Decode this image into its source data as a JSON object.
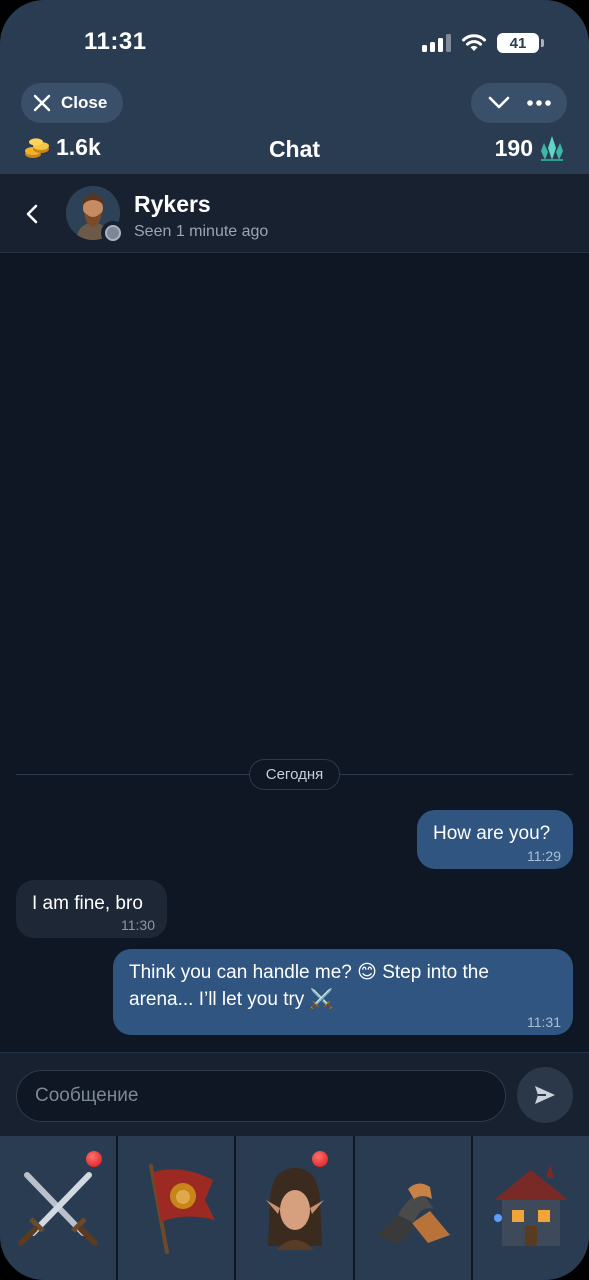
{
  "status_bar": {
    "time": "11:31",
    "battery": "41"
  },
  "header": {
    "close_label": "Close",
    "title": "Chat",
    "gold": "1.6k",
    "gems": "190"
  },
  "contact": {
    "name": "Rykers",
    "status": "Seen 1 minute ago"
  },
  "date_separator": "Сегодня",
  "messages": [
    {
      "direction": "outgoing",
      "text": "How are you?",
      "time": "11:29"
    },
    {
      "direction": "incoming",
      "text": "I am fine, bro",
      "time": "11:30"
    },
    {
      "direction": "outgoing",
      "text": "Think you can handle me? 😊 Step into the arena... I’ll let you try ⚔️",
      "time": "11:31"
    }
  ],
  "composer": {
    "placeholder": "Сообщение"
  },
  "tabs": [
    {
      "icon": "crossed-swords-icon",
      "notification": true
    },
    {
      "icon": "lion-banner-icon",
      "notification": false
    },
    {
      "icon": "elf-portrait-icon",
      "notification": true
    },
    {
      "icon": "handshake-icon",
      "notification": false
    },
    {
      "icon": "tavern-house-icon",
      "notification": false
    }
  ],
  "colors": {
    "background": "#0f1624",
    "header": "#2a3c52",
    "outgoing_bubble": "#2f5580",
    "incoming_bubble": "#1d2736",
    "notification_dot": "#e01c1c"
  }
}
